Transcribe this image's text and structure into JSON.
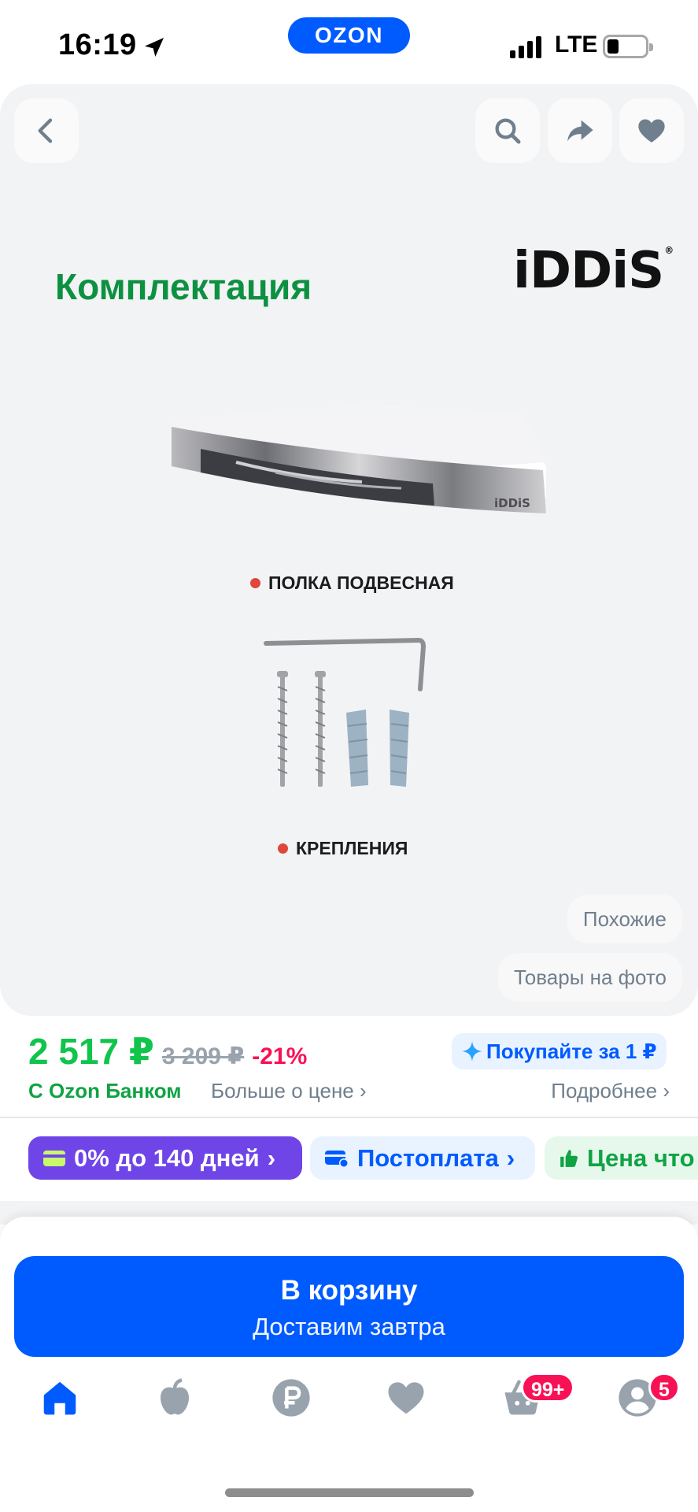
{
  "status_bar": {
    "time": "16:19",
    "network": "LTE",
    "app_logo": "OZON"
  },
  "gallery": {
    "heading": "Комплектация",
    "brand_logo": "iDDiS",
    "labels": [
      "ПОЛКА ПОДВЕСНАЯ",
      "КРЕПЛЕНИЯ"
    ],
    "chips": {
      "similar": "Похожие",
      "photo_goods": "Товары на фото"
    },
    "icons": [
      "back-icon",
      "search-icon",
      "share-icon",
      "heart-icon"
    ]
  },
  "price": {
    "current": "2 517 ₽",
    "old": "3 209 ₽",
    "discount": "-21%",
    "bank": "С Ozon Банком",
    "more": "Больше о цене",
    "promo": "Покупайте за 1 ₽",
    "details": "Подробнее"
  },
  "pills": {
    "installment": "0% до 140 дней",
    "postpay": "Постоплата",
    "price_why": "Цена что"
  },
  "cart": {
    "title": "В корзину",
    "subtitle": "Доставим завтра"
  },
  "tabbar": {
    "items": [
      "home",
      "fresh",
      "ruble",
      "favorites",
      "cart",
      "profile"
    ],
    "cart_badge": "99+",
    "profile_badge": "5"
  },
  "colors": {
    "brand": "#005bff",
    "price_green": "#10c44c",
    "discount": "#f91155",
    "installment": "#6f45e8"
  }
}
